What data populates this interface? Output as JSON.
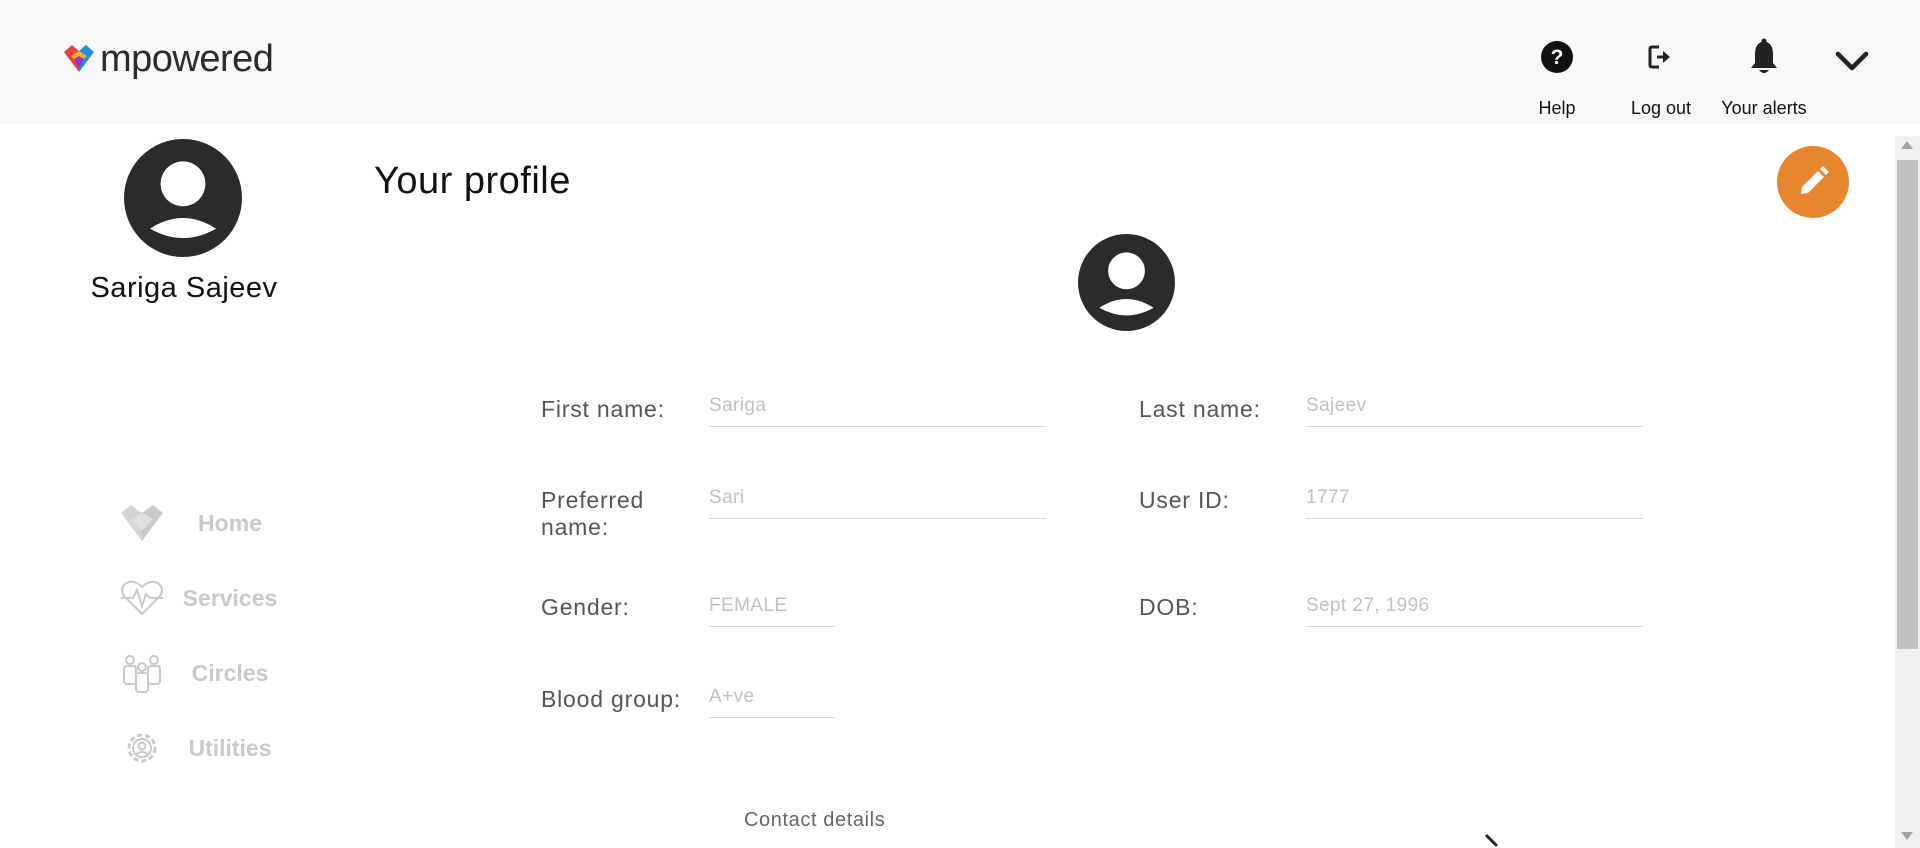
{
  "header": {
    "logo_text": "mpowered",
    "help_label": "Help",
    "logout_label": "Log out",
    "alerts_label": "Your alerts"
  },
  "profile_panel": {
    "name": "Sariga Sajeev"
  },
  "nav": {
    "items": [
      {
        "label": "Home",
        "icon": "heart-logo-icon"
      },
      {
        "label": "Services",
        "icon": "heartbeat-icon"
      },
      {
        "label": "Circles",
        "icon": "people-group-icon"
      },
      {
        "label": "Utilities",
        "icon": "gear-icon"
      }
    ]
  },
  "main": {
    "title": "Your profile",
    "fields": {
      "first_name": {
        "label": "First name:",
        "value": "Sariga"
      },
      "last_name": {
        "label": "Last name:",
        "value": "Sajeev"
      },
      "preferred_name": {
        "label": "Preferred name:",
        "value": "Sari"
      },
      "user_id": {
        "label": "User ID:",
        "value": "1777"
      },
      "gender": {
        "label": "Gender:",
        "value": "FEMALE"
      },
      "dob": {
        "label": "DOB:",
        "value": "Sept 27, 1996"
      },
      "blood_group": {
        "label": "Blood group:",
        "value": "A+ve"
      }
    },
    "contact_details_label": "Contact details"
  },
  "colors": {
    "accent": "#e8852f",
    "header_bg": "#f8f8f8",
    "nav_disabled": "#c9c9c9",
    "avatar": "#2b2b2b"
  }
}
